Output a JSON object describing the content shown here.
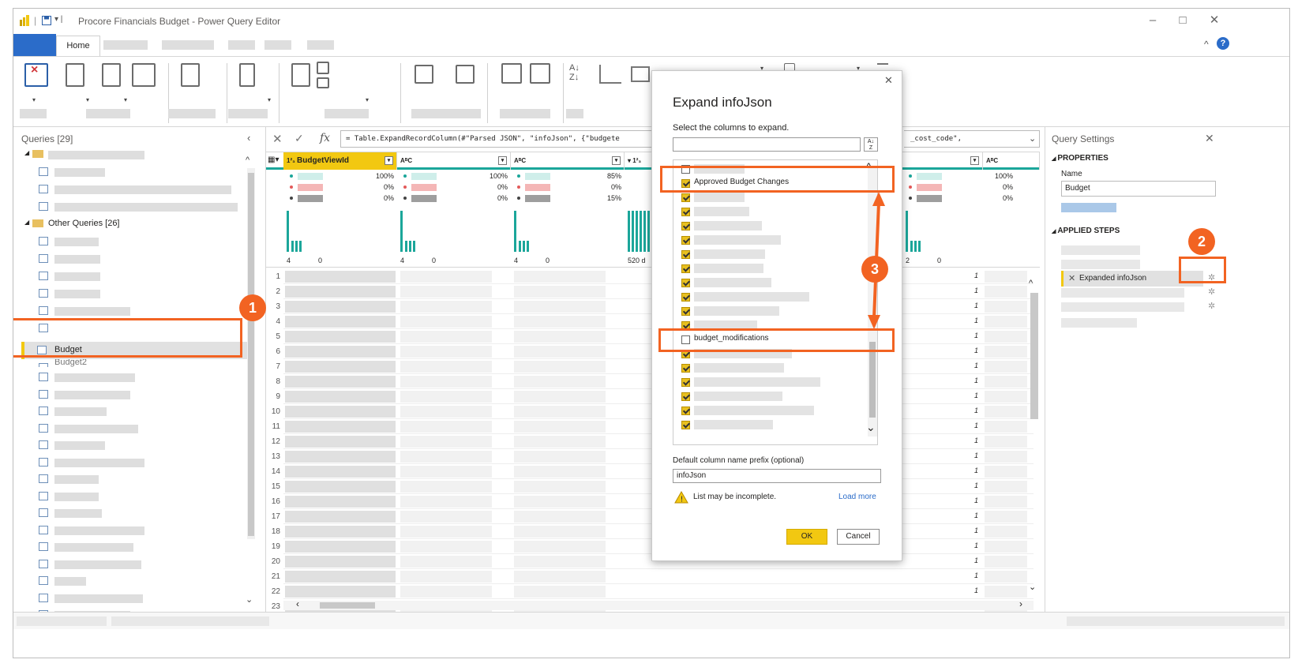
{
  "window": {
    "title": "Procore Financials Budget - Power Query Editor"
  },
  "ribbon": {
    "home_tab": "Home"
  },
  "queries": {
    "header": "Queries [29]",
    "group_other": "Other Queries [26]",
    "selected_item": "Budget",
    "partial_item": "Budget2"
  },
  "formula": {
    "text": "= Table.ExpandRecordColumn(#\"Parsed JSON\", \"infoJson\", {\"budgete",
    "tail": "_cost_code\","
  },
  "columns": {
    "first_header": "BudgetViewId",
    "col1_pcts": [
      "100%",
      "0%",
      "0%"
    ],
    "col2_pcts": [
      "100%",
      "0%",
      "0%"
    ],
    "col3_pcts": [
      "85%",
      "0%",
      "15%"
    ],
    "col5_pcts": [
      "100%",
      "0%",
      "0%"
    ],
    "dist_labels": [
      "4",
      "0",
      "4",
      "0",
      "4",
      "0",
      "520 d",
      "2",
      "0"
    ],
    "row_value": "1"
  },
  "rows": [
    "1",
    "2",
    "3",
    "4",
    "5",
    "6",
    "7",
    "8",
    "9",
    "10",
    "11",
    "12",
    "13",
    "14",
    "15",
    "16",
    "17",
    "18",
    "19",
    "20",
    "21",
    "22",
    "23"
  ],
  "settings": {
    "header": "Query Settings",
    "properties": "PROPERTIES",
    "name_label": "Name",
    "name_value": "Budget",
    "applied_steps": "APPLIED STEPS",
    "selected_step": "Expanded infoJson"
  },
  "dialog": {
    "title": "Expand infoJson",
    "subtitle": "Select the columns to expand.",
    "item_checked_top": "Approved Budget Changes",
    "item_unchecked": "budget_modifications",
    "prefix_label": "Default column name prefix (optional)",
    "prefix_value": "infoJson",
    "warning": "List may be incomplete.",
    "load_more": "Load more",
    "ok": "OK",
    "cancel": "Cancel"
  },
  "annotations": [
    "1",
    "2",
    "3"
  ],
  "colors": {
    "accent_orange": "#f26322",
    "ok_yellow": "#f2c811",
    "file_blue": "#2b6cc9"
  }
}
